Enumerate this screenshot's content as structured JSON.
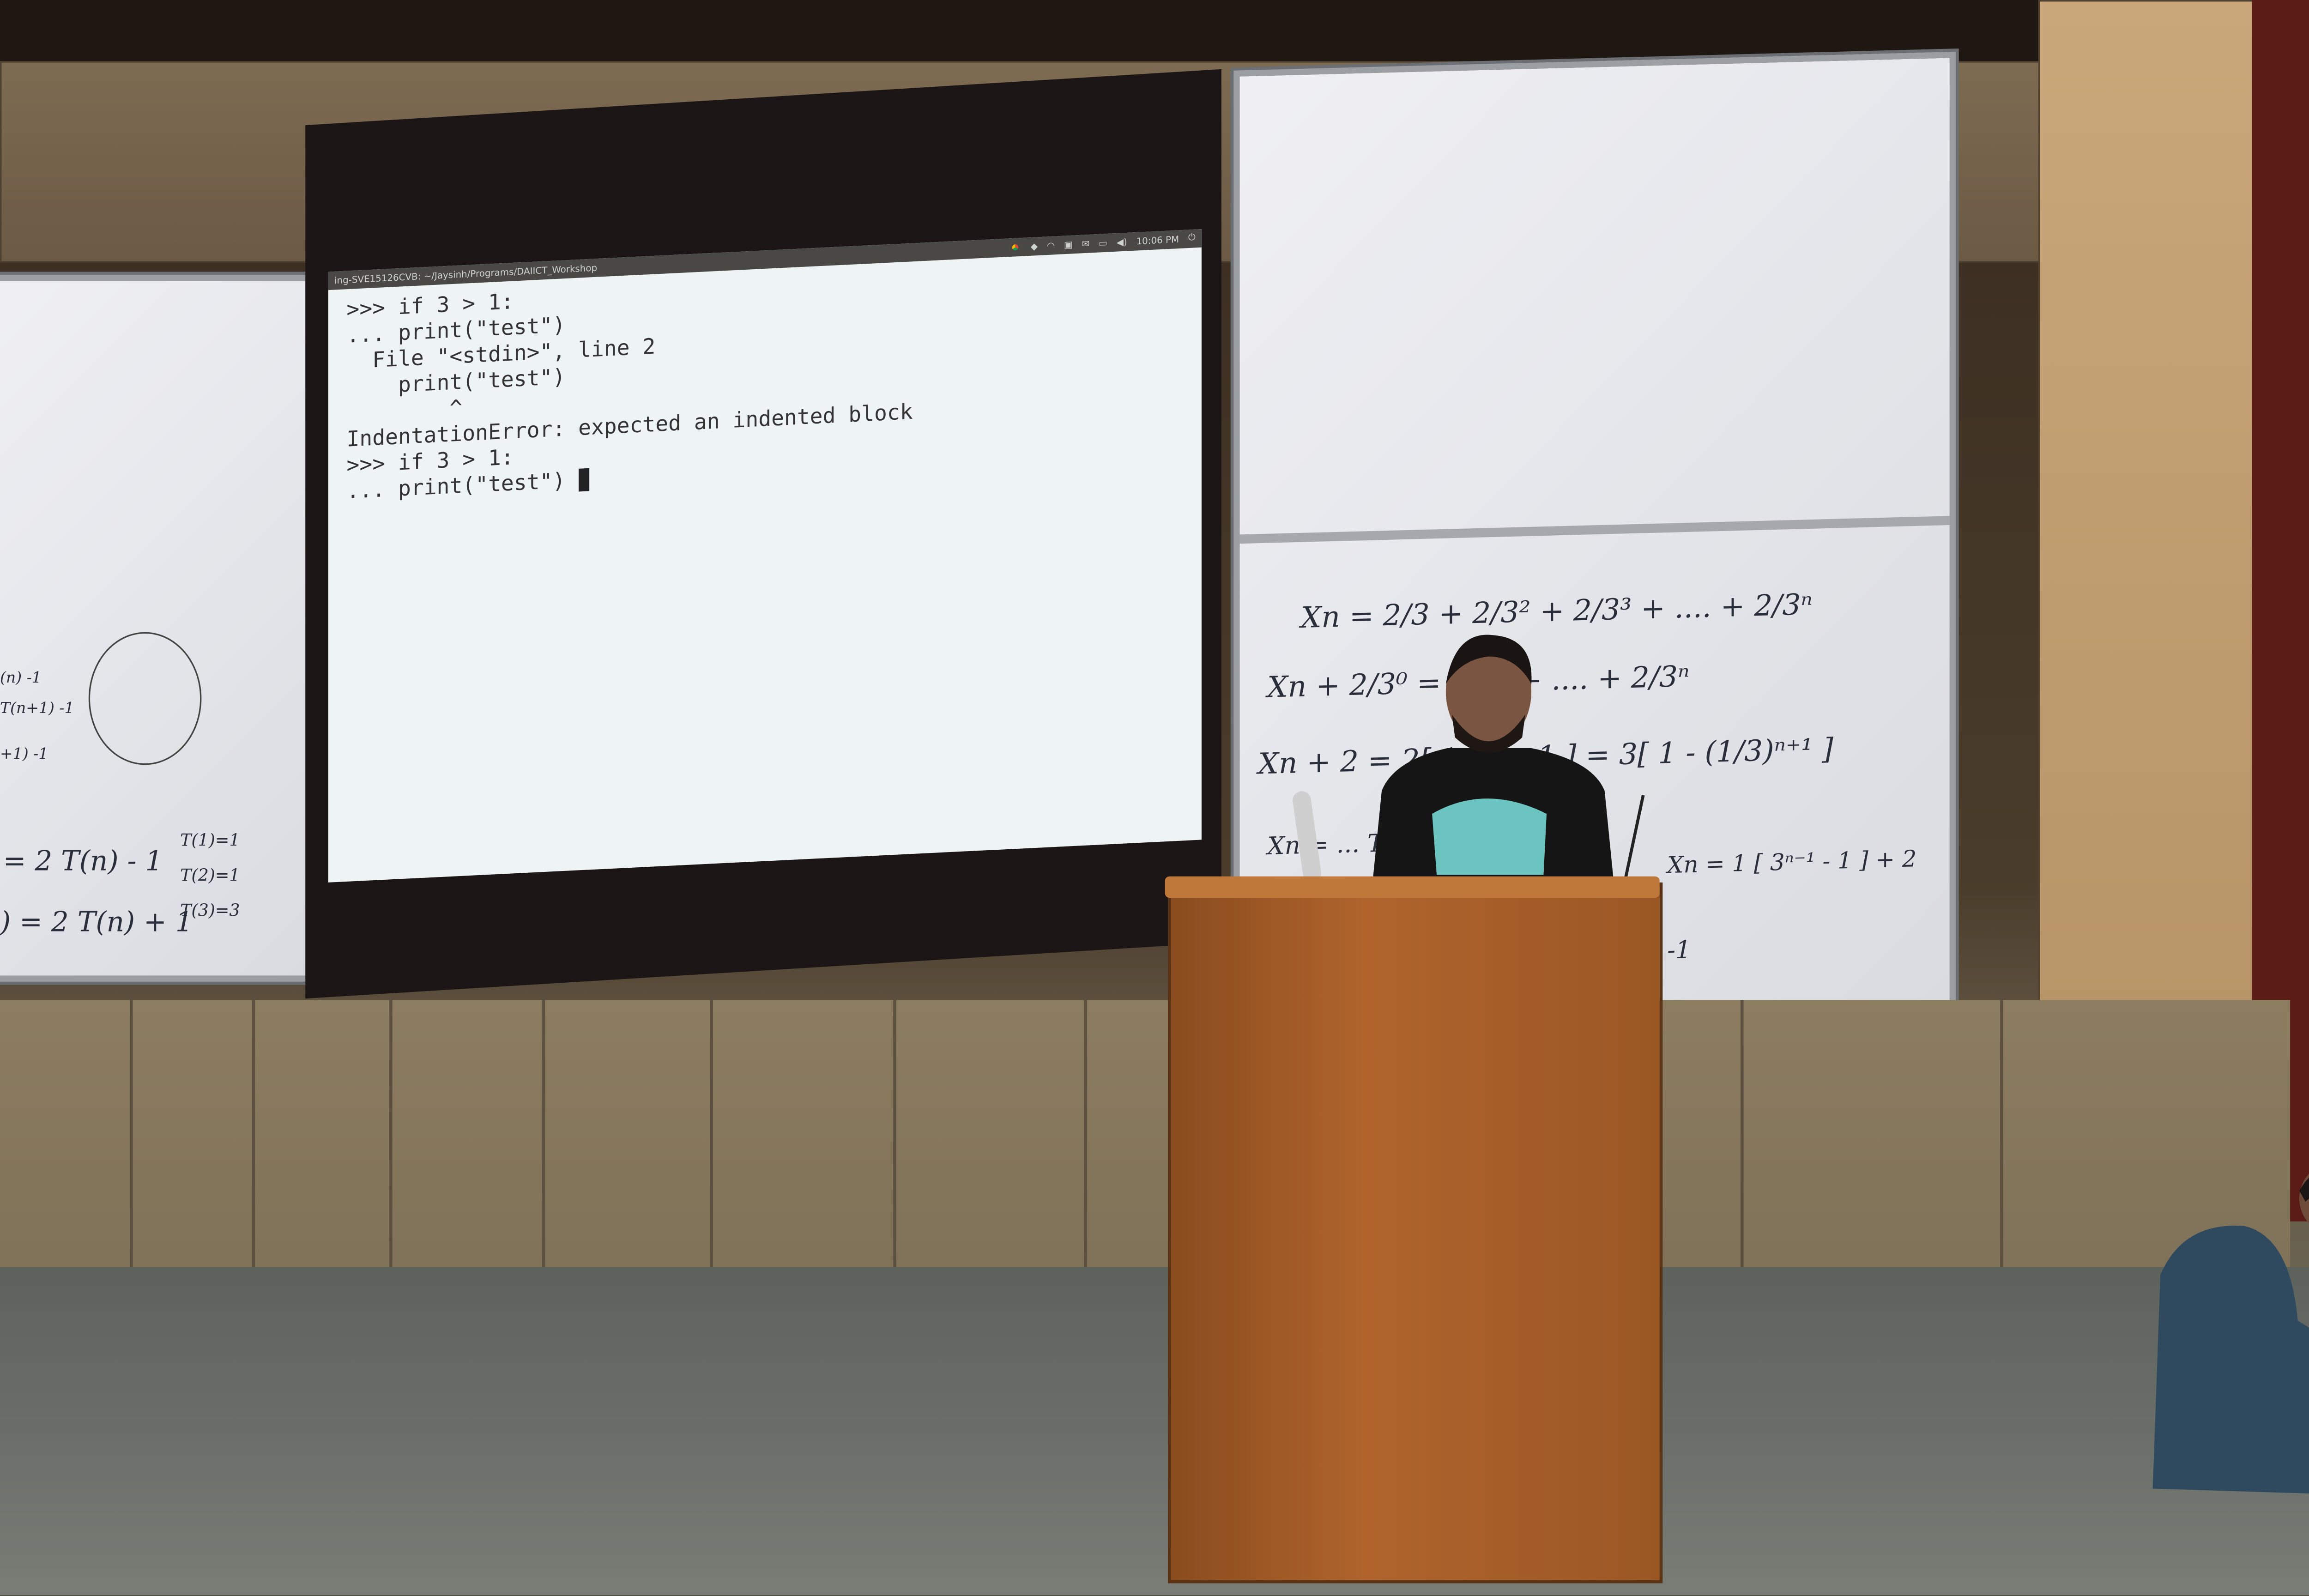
{
  "terminal": {
    "title": "ing-SVE15126CVB: ~/Jaysinh/Programs/DAIICT_Workshop",
    "clock": "10:06 PM",
    "tray_icons": [
      "chrome-icon",
      "dropbox-icon",
      "wifi-icon",
      "keyboard-layout-icon",
      "mail-icon",
      "battery-icon",
      "volume-icon",
      "power-icon"
    ],
    "lines": [
      ">>> if 3 > 1:",
      "... print(\"test\")",
      "  File \"<stdin>\", line 2",
      "    print(\"test\")",
      "        ^",
      "IndentationError: expected an indented block",
      ">>> if 3 > 1:",
      "... print(\"test\") "
    ]
  },
  "left_board": {
    "lines": [
      "T(1)=1",
      "T(2)=1",
      "T(3)=3",
      "= 2 T(n) - 1",
      ") = 2 T(n) + 1",
      "(n) -1",
      "T(n+1) -1",
      "+1) -1"
    ]
  },
  "right_board": {
    "lines": [
      "Xn = 2/3 + 2/3² + 2/3³ + .... + 2/3ⁿ",
      "Xn + 2/3⁰ = 2/3⁰ + .... + 2/3ⁿ",
      "Xn + 2 = 2[ ( ... ) - 1 ] = 3[ 1 - (1/3)ⁿ⁺¹ ]",
      "Xn = ... Tn-1 + 2",
      "Xn = 1 [ 3ⁿ⁻¹ - 1 ] + 2",
      "-1"
    ]
  },
  "colors": {
    "screen_bg": "#eef3f4",
    "topbar": "#4a4844",
    "podium": "#b0642c",
    "shirt": "#151515",
    "shirt_print": "#6cc4c0"
  }
}
